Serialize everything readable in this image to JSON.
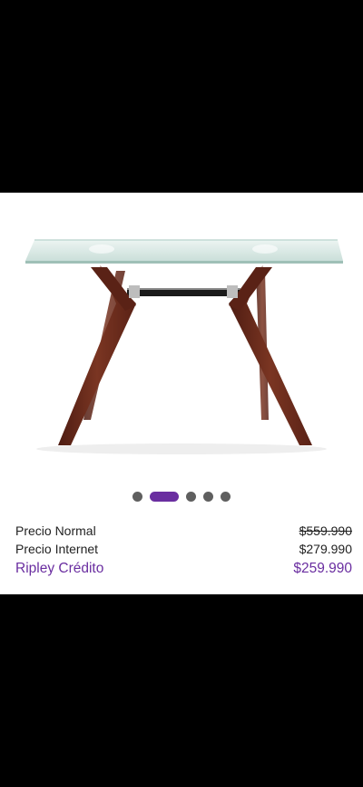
{
  "product": {
    "image_alt": "glass console table with wooden legs",
    "carousel": {
      "dot_count": 5,
      "active_index": 1
    }
  },
  "prices": {
    "normal": {
      "label": "Precio Normal",
      "value": "$559.990"
    },
    "internet": {
      "label": "Precio Internet",
      "value": "$279.990"
    },
    "credit": {
      "label": "Ripley Crédito",
      "value": "$259.990"
    }
  },
  "colors": {
    "accent": "#6a2ea0",
    "dot_inactive": "#5f5f5f",
    "wood": "#6b2a1c",
    "glass": "#cfe3df"
  }
}
